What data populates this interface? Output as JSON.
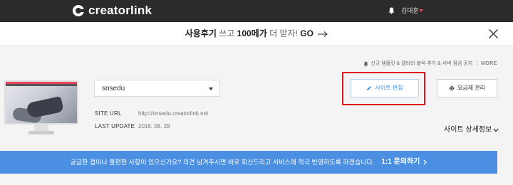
{
  "header": {
    "brand": "creatorlink",
    "user_name": "김대훈",
    "colors": {
      "bg": "#2b2b2b",
      "accent": "#e4455c"
    }
  },
  "promo": {
    "part1": "사용후기",
    "part2": "쓰고",
    "part3": "100메가",
    "part4": "더",
    "part5": "받자!",
    "part6": "GO",
    "close_icon": "close-icon"
  },
  "notice": {
    "text": "신규 템플릿 & 갤러리 블럭 추가 & 서버 점검 공지",
    "more": "MORE"
  },
  "site": {
    "selected": "snsedu",
    "url_label": "SITE URL",
    "url_value": "http://snsedu.creatorlink.net",
    "updated_label": "LAST UPDATE",
    "updated_value": "2016. 08. 29"
  },
  "actions": {
    "edit_label": "사이트 편집",
    "manage_label": "요금제 관리",
    "detail_label": "사이트 상세정보",
    "accent": "#3b8fe0"
  },
  "banner": {
    "text": "궁금한 점이나 불편한 사항이 있으신가요? 의견 남겨주시면 바로 회신드리고 서비스에 적극 반영하도록 하겠습니다.",
    "link": "1:1 문의하기",
    "color": "#4a8fe2"
  }
}
